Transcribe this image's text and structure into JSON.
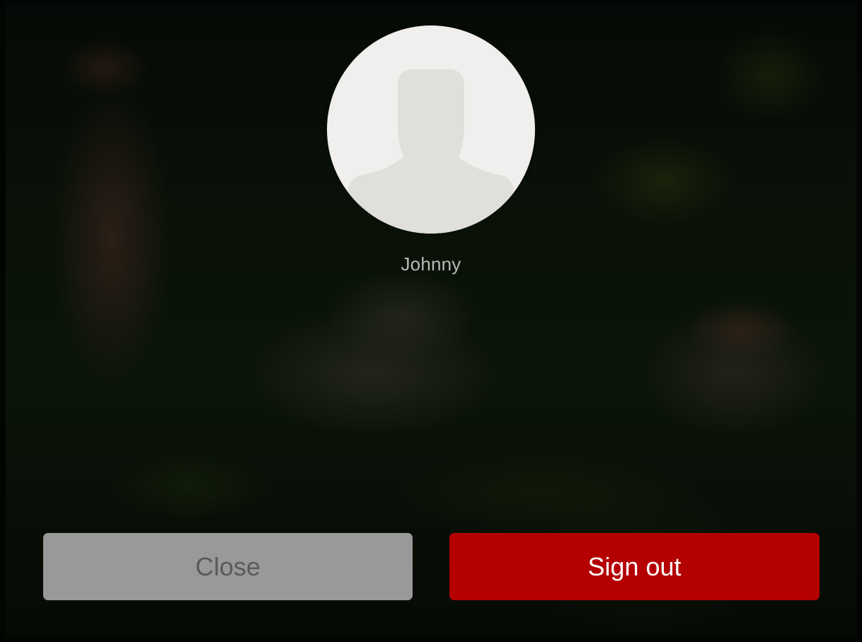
{
  "user": {
    "name": "Johnny",
    "avatar_icon": "default-user-silhouette-icon"
  },
  "actions": {
    "close_label": "Close",
    "sign_out_label": "Sign out"
  },
  "colors": {
    "sign_out_background": "#b40000",
    "close_background": "#999999",
    "avatar_background": "#f0efed",
    "silhouette": "#e1dfdb"
  }
}
